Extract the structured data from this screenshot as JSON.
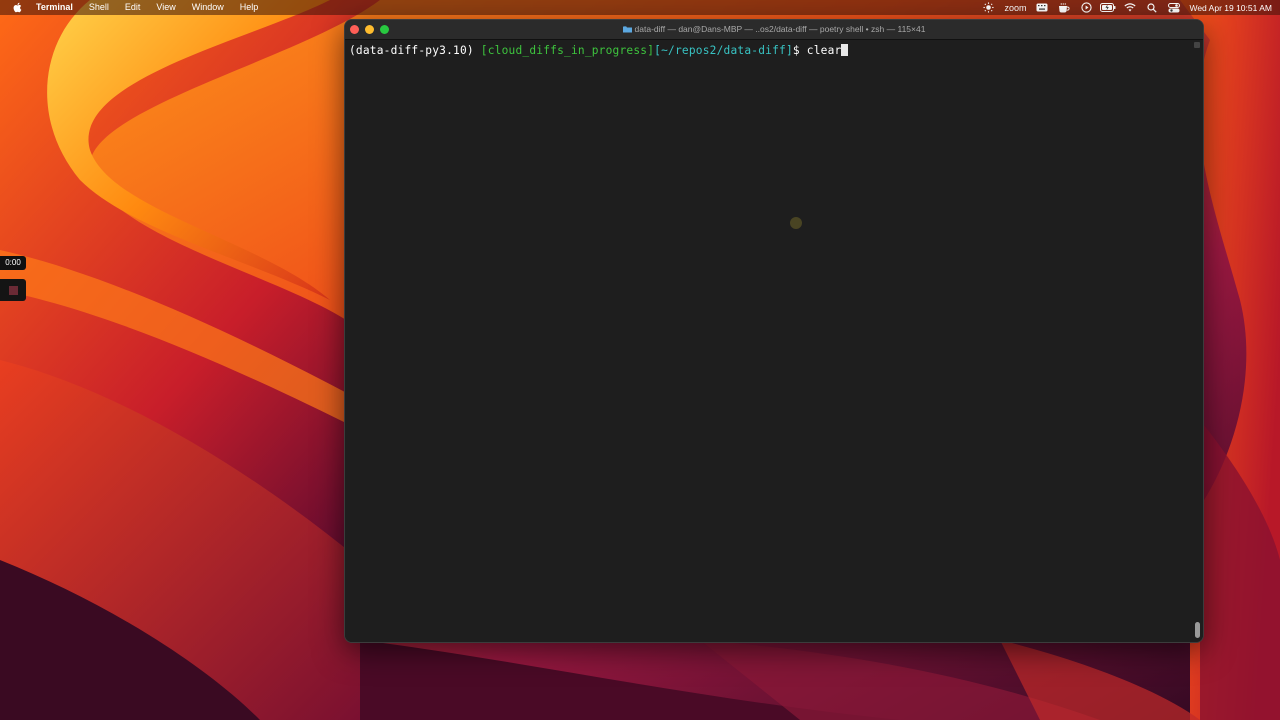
{
  "menubar": {
    "app_name": "Terminal",
    "items": [
      "Shell",
      "Edit",
      "View",
      "Window",
      "Help"
    ],
    "zoom_label": "zoom",
    "clock": "Wed Apr 19  10:51 AM",
    "tray_icons": [
      "brightness-icon",
      "zoom-label",
      "keyboard-icon",
      "coffee-icon",
      "play-icon",
      "battery-icon",
      "wifi-icon",
      "search-icon",
      "control-center-icon"
    ]
  },
  "recording": {
    "timer": "0:00"
  },
  "terminal": {
    "title": "data-diff — dan@Dans-MBP — ..os2/data-diff — poetry shell • zsh — 115×41",
    "prompt": {
      "env": "(data-diff-py3.10)",
      "branch": "[cloud_diffs_in_progress]",
      "path": "[~/repos2/data-diff]",
      "dollar": "$",
      "command": "clear"
    }
  },
  "colors": {
    "branch": "#3ec43e",
    "path": "#38c2c2",
    "close": "#ff5f57",
    "minimize": "#febc2e",
    "maximize": "#28c840"
  }
}
